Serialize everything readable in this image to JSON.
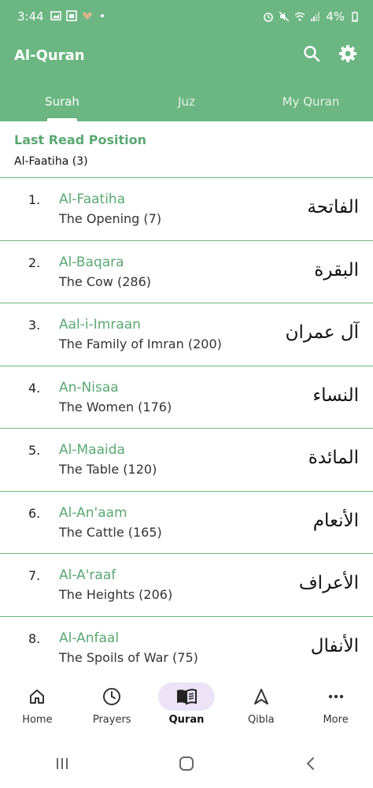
{
  "status_bar": {
    "time": "3:44",
    "battery": "4%",
    "icons": [
      "gallery-icon",
      "image-icon",
      "heart-icon",
      "dot-icon",
      "alarm-icon",
      "mute-icon",
      "wifi-icon",
      "signal-icon",
      "battery-icon"
    ]
  },
  "app_bar": {
    "title": "Al-Quran",
    "actions": [
      "search-icon",
      "settings-icon"
    ],
    "tabs": [
      {
        "label": "Surah",
        "active": true
      },
      {
        "label": "Juz",
        "active": false
      },
      {
        "label": "My Quran",
        "active": false
      }
    ]
  },
  "last_read": {
    "title": "Last Read Position",
    "value": "Al-Faatiha (3)"
  },
  "surahs": [
    {
      "number": "1.",
      "name": "Al-Faatiha",
      "meaning": "The Opening (7)",
      "arabic": "الفاتحة"
    },
    {
      "number": "2.",
      "name": "Al-Baqara",
      "meaning": "The Cow (286)",
      "arabic": "البقرة"
    },
    {
      "number": "3.",
      "name": "Aal-i-Imraan",
      "meaning": "The Family of Imran (200)",
      "arabic": "آل عمران"
    },
    {
      "number": "4.",
      "name": "An-Nisaa",
      "meaning": "The Women (176)",
      "arabic": "النساء"
    },
    {
      "number": "5.",
      "name": "Al-Maaida",
      "meaning": "The Table (120)",
      "arabic": "المائدة"
    },
    {
      "number": "6.",
      "name": "Al-An'aam",
      "meaning": "The Cattle (165)",
      "arabic": "الأنعام"
    },
    {
      "number": "7.",
      "name": "Al-A'raaf",
      "meaning": "The Heights (206)",
      "arabic": "الأعراف"
    },
    {
      "number": "8.",
      "name": "Al-Anfaal",
      "meaning": "The Spoils of War (75)",
      "arabic": "الأنفال"
    }
  ],
  "bottom_nav": [
    {
      "label": "Home",
      "icon": "home-icon",
      "active": false
    },
    {
      "label": "Prayers",
      "icon": "clock-icon",
      "active": false
    },
    {
      "label": "Quran",
      "icon": "book-icon",
      "active": true
    },
    {
      "label": "Qibla",
      "icon": "compass-arrow-icon",
      "active": false
    },
    {
      "label": "More",
      "icon": "more-icon",
      "active": false
    }
  ],
  "colors": {
    "primary": "#6bb682",
    "accent_text": "#5aa873",
    "active_nav_bg": "#ece3f6"
  }
}
